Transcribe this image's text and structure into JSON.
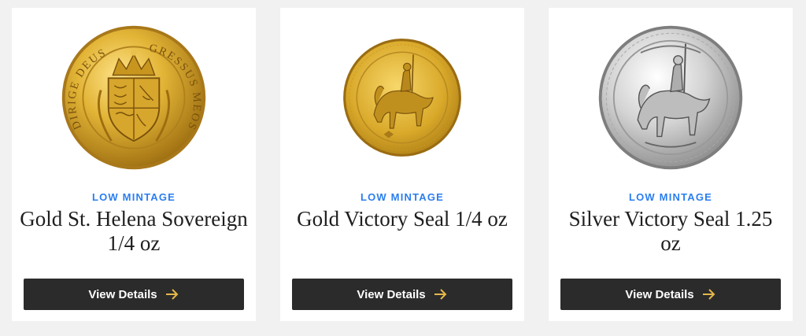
{
  "colors": {
    "accent": "#2a7ef0",
    "button_bg": "#2b2b2b",
    "arrow": "#e4b84a"
  },
  "products": [
    {
      "badge": "LOW MINTAGE",
      "title": "Gold St. Helena Sovereign 1/4 oz",
      "button_label": "View Details",
      "button_icon": "arrow-right-icon",
      "image": {
        "icon": "gold-coin-shield-crest",
        "legend_left": "DIRIGE DEUS",
        "legend_right": "GRESSUS MEOS"
      }
    },
    {
      "badge": "LOW MINTAGE",
      "title": "Gold Victory Seal 1/4 oz",
      "button_label": "View Details",
      "button_icon": "arrow-right-icon",
      "image": {
        "icon": "gold-coin-equestrian"
      }
    },
    {
      "badge": "LOW MINTAGE",
      "title": "Silver Victory Seal 1.25 oz",
      "button_label": "View Details",
      "button_icon": "arrow-right-icon",
      "image": {
        "icon": "silver-coin-equestrian"
      }
    }
  ]
}
